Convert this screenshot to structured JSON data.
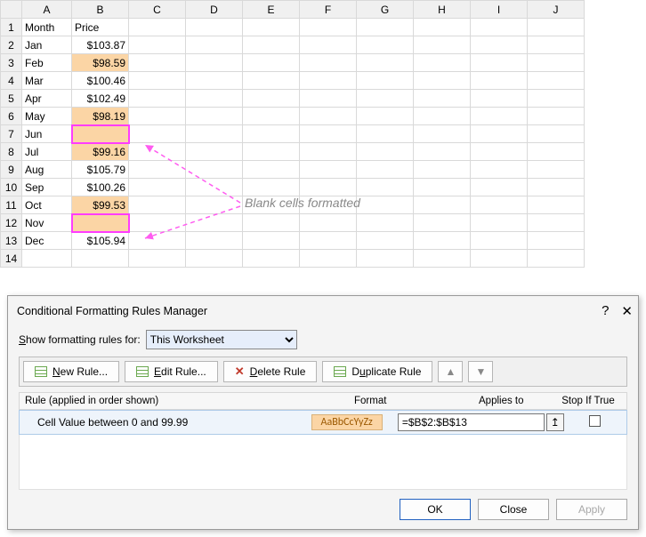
{
  "sheet": {
    "columns": [
      "A",
      "B",
      "C",
      "D",
      "E",
      "F",
      "G",
      "H",
      "I",
      "J"
    ],
    "rows_shown": 14,
    "header": {
      "A": "Month",
      "B": "Price"
    },
    "data": [
      {
        "A": "Jan",
        "B": "$103.87",
        "hl": false
      },
      {
        "A": "Feb",
        "B": "$98.59",
        "hl": true
      },
      {
        "A": "Mar",
        "B": "$100.46",
        "hl": false
      },
      {
        "A": "Apr",
        "B": "$102.49",
        "hl": false
      },
      {
        "A": "May",
        "B": "$98.19",
        "hl": true
      },
      {
        "A": "Jun",
        "B": "",
        "hl": true,
        "selected": true
      },
      {
        "A": "Jul",
        "B": "$99.16",
        "hl": true
      },
      {
        "A": "Aug",
        "B": "$105.79",
        "hl": false
      },
      {
        "A": "Sep",
        "B": "$100.26",
        "hl": false
      },
      {
        "A": "Oct",
        "B": "$99.53",
        "hl": true
      },
      {
        "A": "Nov",
        "B": "",
        "hl": true,
        "selected": true
      },
      {
        "A": "Dec",
        "B": "$105.94",
        "hl": false
      }
    ]
  },
  "annotation": {
    "text": "Blank cells formatted"
  },
  "dialog": {
    "title": "Conditional Formatting Rules Manager",
    "help_icon": "?",
    "close_icon": "✕",
    "scope_label_pre": "S",
    "scope_label_rest": "how formatting rules for:",
    "scope_value": "This Worksheet",
    "toolbar": {
      "new_pre": "N",
      "new_rest": "ew Rule...",
      "edit_pre": "E",
      "edit_rest": "dit Rule...",
      "del_pre": "D",
      "del_rest": "elete Rule",
      "dup_pre": "u",
      "dup_pre_full": "D",
      "dup_rest": "plicate Rule",
      "up": "▲",
      "down": "▼"
    },
    "list_header": {
      "rule": "Rule (applied in order shown)",
      "format": "Format",
      "applies": "Applies to",
      "stop": "Stop If True"
    },
    "rule": {
      "desc": "Cell Value between 0 and 99.99",
      "preview": "AaBbCcYyZz",
      "range": "=$B$2:$B$13",
      "collapse_icon": "↥"
    },
    "footer": {
      "ok": "OK",
      "close": "Close",
      "apply": "Apply"
    }
  }
}
